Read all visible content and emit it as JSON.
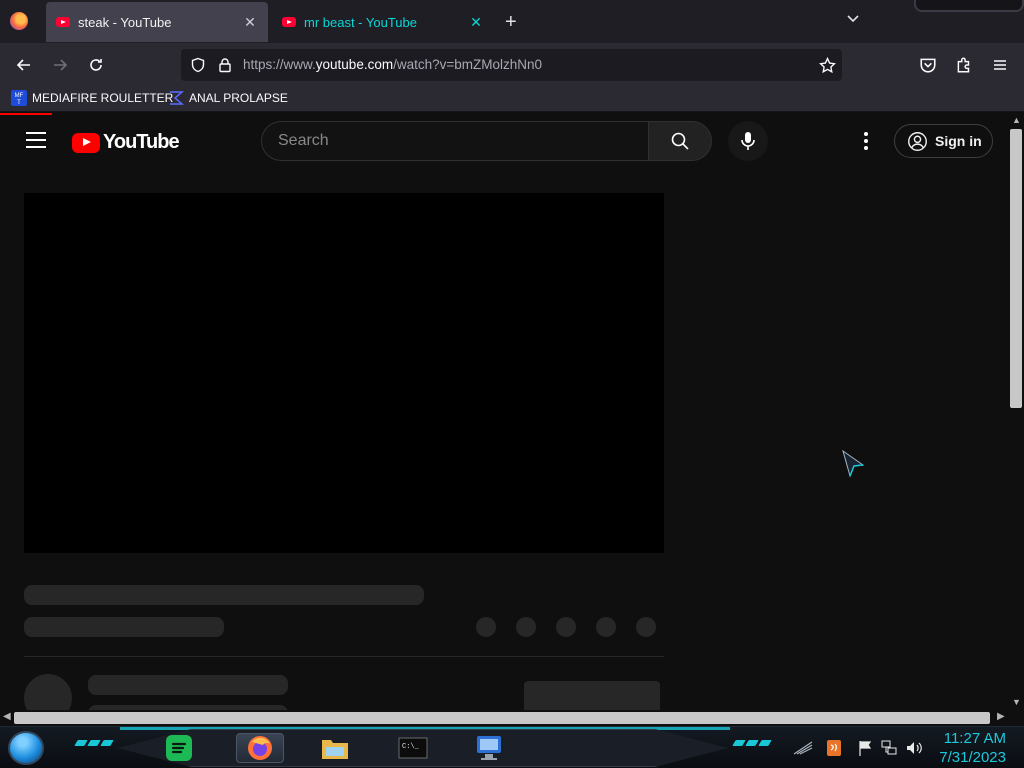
{
  "browser": {
    "tabs": [
      {
        "title": "steak - YouTube",
        "active": true
      },
      {
        "title": "mr beast - YouTube",
        "active": false
      }
    ],
    "new_tab": "+",
    "url_prefix": "https://www.",
    "url_host": "youtube.com",
    "url_path": "/watch?v=bmZMolzhNn0",
    "bookmarks": [
      {
        "label": "MEDIAFIRE ROULETTER"
      },
      {
        "label": "ANAL PROLAPSE"
      }
    ],
    "icons": {
      "back": "arrow-left-icon",
      "forward": "arrow-right-icon",
      "reload": "reload-icon",
      "shield": "shield-icon",
      "lock": "lock-icon",
      "star": "star-icon",
      "pocket": "pocket-icon",
      "extensions": "puzzle-icon",
      "menu": "hamburger-icon"
    }
  },
  "youtube": {
    "logo_text": "YouTube",
    "search_placeholder": "Search",
    "sign_in": "Sign in",
    "colors": {
      "brand_red": "#ff0000",
      "background": "#0f0f0f",
      "skeleton": "#272727"
    }
  },
  "taskbar": {
    "time": "11:27 AM",
    "date": "7/31/2023",
    "apps": [
      "spotify-icon",
      "firefox-icon",
      "file-explorer-icon",
      "terminal-icon",
      "remote-desktop-icon"
    ],
    "accent_color": "#18c8d8"
  }
}
